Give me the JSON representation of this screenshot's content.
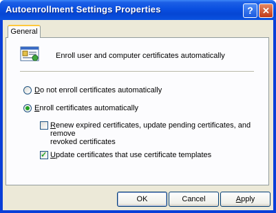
{
  "window": {
    "title": "Autoenrollment Settings Properties",
    "help_glyph": "?",
    "close_glyph": "✕"
  },
  "tabs": [
    {
      "label": "General",
      "selected": true
    }
  ],
  "header": {
    "text": "Enroll user and computer certificates automatically",
    "icon": "certificate-icon"
  },
  "options": {
    "no_enroll": {
      "prefix": "D",
      "rest": "o not enroll certificates automatically",
      "selected": false
    },
    "enroll": {
      "prefix": "E",
      "rest": "nroll certificates automatically",
      "selected": true
    },
    "renew": {
      "prefix": "R",
      "rest": "enew expired certificates, update pending certificates, and remove",
      "line2": "revoked certificates",
      "checked": false
    },
    "update": {
      "prefix": "U",
      "rest": "pdate certificates that use certificate templates",
      "checked": true
    }
  },
  "buttons": {
    "ok": "OK",
    "cancel": "Cancel",
    "apply_prefix": "A",
    "apply_rest": "pply"
  },
  "colors": {
    "title_bar": "#0a4fe0",
    "dialog_bg": "#ece9d8",
    "accent_green": "#21a121"
  }
}
